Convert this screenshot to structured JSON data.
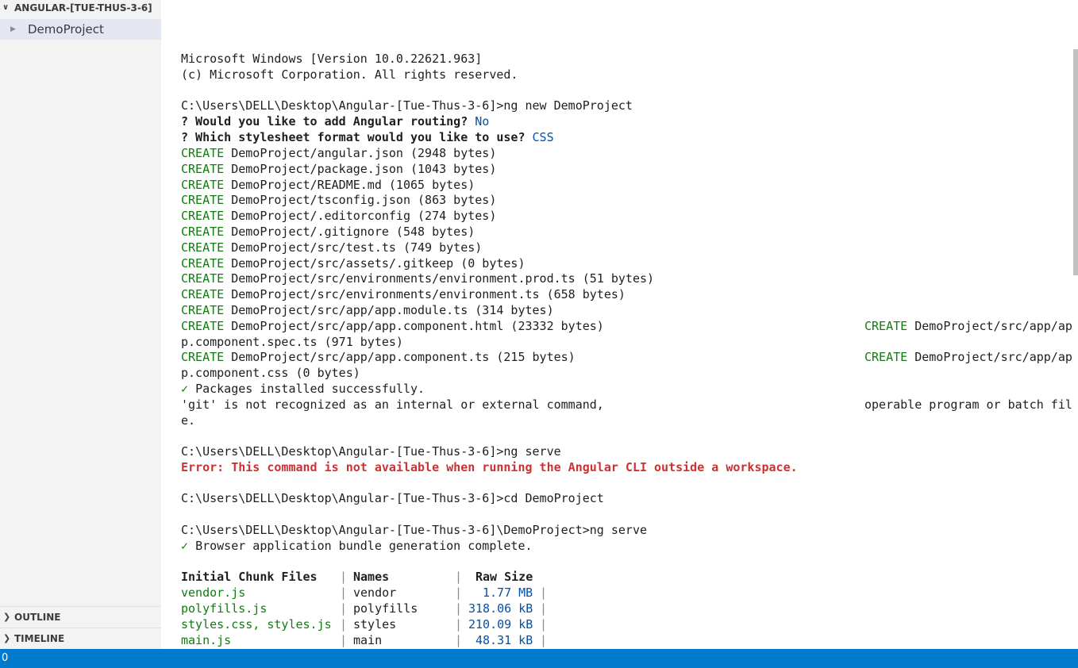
{
  "sidebar": {
    "header": "ANGULAR-[TUE-THUS-3-6]",
    "project": "DemoProject",
    "outline": "OUTLINE",
    "timeline": "TIMELINE"
  },
  "status": {
    "left": "0"
  },
  "terminal": {
    "l1": "Microsoft Windows [Version 10.0.22621.963]",
    "l2": "(c) Microsoft Corporation. All rights reserved.",
    "prompt1": "C:\\Users\\DELL\\Desktop\\Angular-[Tue-Thus-3-6]>ng new DemoProject",
    "q1": "? Would you like to add Angular routing?",
    "q1a": "No",
    "q2": "? Which stylesheet format would you like to use?",
    "q2a": "CSS",
    "create_word": "CREATE",
    "creates": [
      "DemoProject/angular.json (2948 bytes)",
      "DemoProject/package.json (1043 bytes)",
      "DemoProject/README.md (1065 bytes)",
      "DemoProject/tsconfig.json (863 bytes)",
      "DemoProject/.editorconfig (274 bytes)",
      "DemoProject/.gitignore (548 bytes)",
      "DemoProject/src/test.ts (749 bytes)",
      "DemoProject/src/assets/.gitkeep (0 bytes)",
      "DemoProject/src/environments/environment.prod.ts (51 bytes)",
      "DemoProject/src/environments/environment.ts (658 bytes)",
      "DemoProject/src/app/app.module.ts (314 bytes)",
      "DemoProject/src/app/app.component.html (23332 bytes)",
      "DemoProject/src/app/app.component.ts (215 bytes)"
    ],
    "wrap_right": "DemoProject/src/app/ap",
    "wrap1": "p.component.spec.ts (971 bytes)",
    "wrap2": "p.component.css (0 bytes)",
    "check": "✓",
    "pkgs": "Packages installed successfully.",
    "git1": "'git' is not recognized as an internal or external command,",
    "git1r": "operable program or batch fil",
    "git2": "e.",
    "prompt2": "C:\\Users\\DELL\\Desktop\\Angular-[Tue-Thus-3-6]>ng serve",
    "error": "Error: This command is not available when running the Angular CLI outside a workspace.",
    "prompt3": "C:\\Users\\DELL\\Desktop\\Angular-[Tue-Thus-3-6]>cd DemoProject",
    "prompt4": "C:\\Users\\DELL\\Desktop\\Angular-[Tue-Thus-3-6]\\DemoProject>ng serve",
    "bundle": "Browser application bundle generation complete.",
    "table": {
      "headers": [
        "Initial Chunk Files",
        "Names",
        "Raw Size"
      ],
      "rows": [
        [
          "vendor.js",
          "vendor",
          "1.77 MB"
        ],
        [
          "polyfills.js",
          "polyfills",
          "318.06 kB"
        ],
        [
          "styles.css, styles.js",
          "styles",
          "210.09 kB"
        ],
        [
          "main.js",
          "main",
          "48.31 kB"
        ]
      ]
    }
  }
}
